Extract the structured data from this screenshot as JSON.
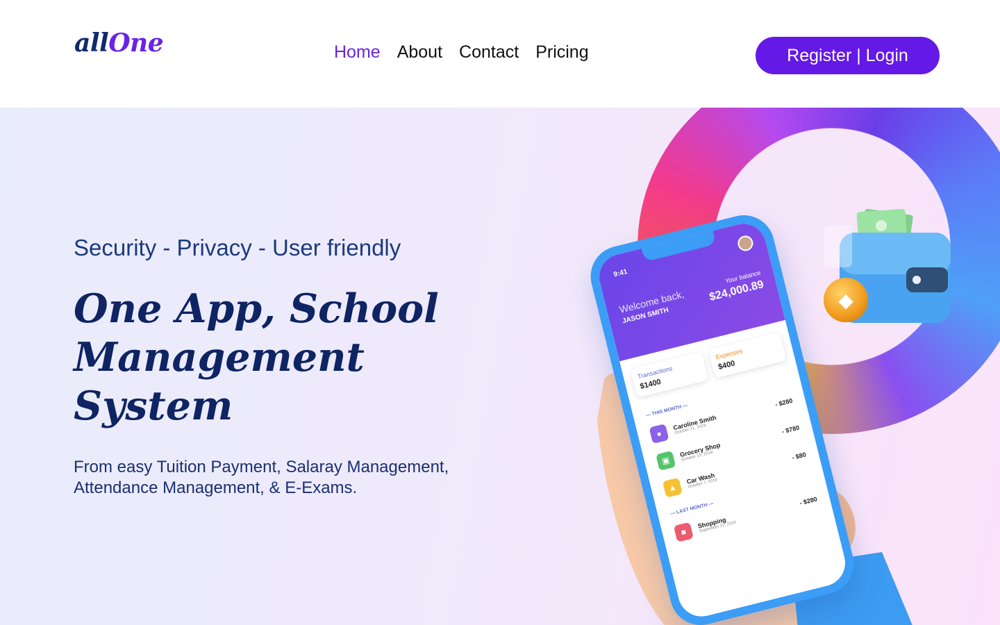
{
  "header": {
    "logo": {
      "part1": "all",
      "part2": "One"
    },
    "nav": [
      {
        "label": "Home",
        "active": true
      },
      {
        "label": "About",
        "active": false
      },
      {
        "label": "Contact",
        "active": false
      },
      {
        "label": "Pricing",
        "active": false
      }
    ],
    "auth_button": "Register | Login"
  },
  "hero": {
    "tagline": "Security - Privacy - User friendly",
    "headline_lines": [
      "One App, School",
      "Management",
      "System"
    ],
    "description_lines": [
      "From easy  Tuition Payment, Salaray Management,",
      "Attendance Management, & E-Exams."
    ]
  },
  "phone": {
    "time": "9:41",
    "welcome": "Welcome back,",
    "user": "JASON SMITH",
    "balance_label": "Your balance",
    "balance": "$24,000.89",
    "cards": [
      {
        "label": "Transactions",
        "value": "$1400"
      },
      {
        "label": "Expenses",
        "value": "$400"
      }
    ],
    "this_month_label": "— THIS MONTH —",
    "last_month_label": "— LAST MONTH —",
    "transactions": [
      {
        "name": "Caroline Smith",
        "date": "October 21, 2019",
        "amount": "- $280"
      },
      {
        "name": "Grocery Shop",
        "date": "October 15, 2019",
        "amount": "- $780"
      },
      {
        "name": "Car Wash",
        "date": "October 7, 2019",
        "amount": "- $80"
      },
      {
        "name": "Shopping",
        "date": "September 21, 2019",
        "amount": "- $280"
      }
    ]
  },
  "colors": {
    "brand_purple": "#6419e6",
    "nav_active": "#6a22e6",
    "heading_navy": "#0e2463",
    "tagline_blue": "#1b3a7e"
  },
  "icons": [
    "wallet-icon",
    "ethereum-coin-icon",
    "cash-icon"
  ]
}
